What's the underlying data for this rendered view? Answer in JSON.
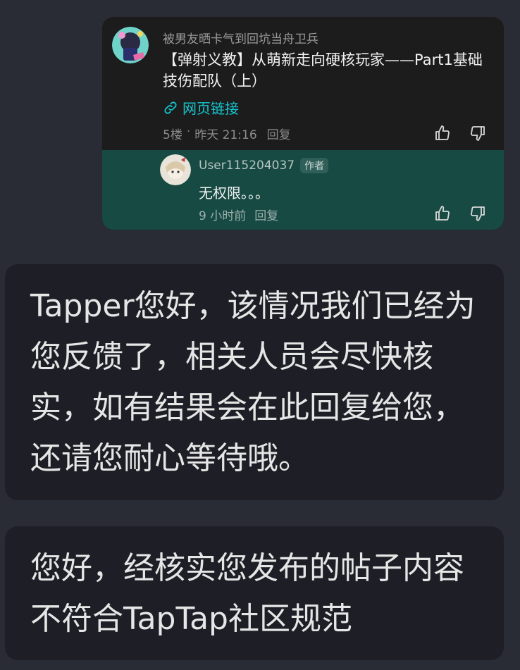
{
  "post": {
    "author": "被男友晒卡气到回坑当舟卫兵",
    "title": "【弹射义教】从萌新走向硬核玩家——Part1基础技伤配队（上）",
    "link_label": "网页链接",
    "floor": "5楼",
    "separator": "·",
    "time": "昨天 21:16",
    "reply_label": "回复",
    "colors": {
      "link": "#15c5ce",
      "card_bg": "#1c1c1c"
    }
  },
  "sub_reply": {
    "username": "User115204037",
    "badge": "作者",
    "text": "无权限。。。",
    "time": "9 小时前",
    "reply_label": "回复",
    "colors": {
      "bg": "#164a43"
    }
  },
  "messages": [
    {
      "text": "Tapper您好，该情况我们已经为您反馈了，相关人员会尽快核实，如有结果会在此回复给您，还请您耐心等待哦。"
    },
    {
      "text": "您好，经核实您发布的帖子内容不符合TapTap社区规范"
    }
  ],
  "icons": [
    "avatar",
    "link-icon",
    "thumb-up-icon",
    "thumb-down-icon"
  ]
}
